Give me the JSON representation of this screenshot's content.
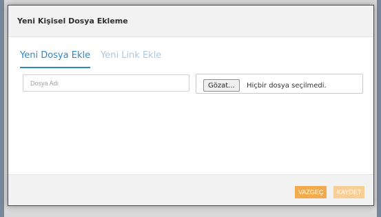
{
  "dialog": {
    "title": "Yeni Kişisel Dosya Ekleme"
  },
  "tabs": [
    {
      "label": "Yeni Dosya Ekle",
      "active": true
    },
    {
      "label": "Yeni Link Ekle",
      "active": false
    }
  ],
  "form": {
    "file_name_placeholder": "Dosya Adı",
    "file_name_value": "",
    "browse_label": "Gözat...",
    "no_file_text": "Hiçbir dosya seçilmedi."
  },
  "footer": {
    "cancel_label": "VAZGEÇ",
    "save_label": "KAYDET"
  },
  "colors": {
    "active_tab": "#2b87c9",
    "inactive_tab": "#aec8dc",
    "cancel_button": "#f1ab4c",
    "save_button": "#f7cf96"
  }
}
